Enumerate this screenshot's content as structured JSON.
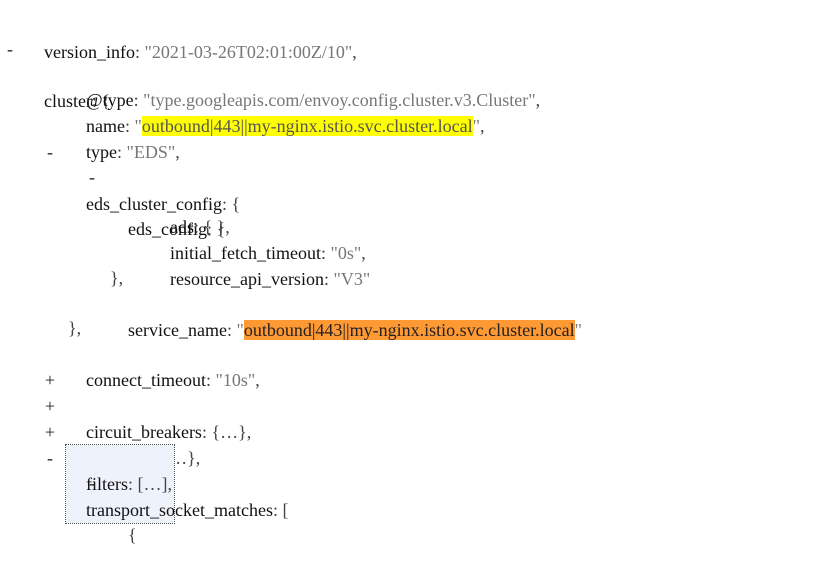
{
  "lines": {
    "version_info": {
      "key": "version_info",
      "value": "2021-03-26T02:01:00Z/10"
    },
    "cluster": {
      "toggle": "-",
      "key": "cluster",
      "open": "{"
    },
    "type_url": {
      "key": "@type",
      "value": "type.googleapis.com/envoy.config.cluster.v3.Cluster"
    },
    "name": {
      "key": "name",
      "value": "outbound|443||my-nginx.istio.svc.cluster.local"
    },
    "type": {
      "key": "type",
      "value": "EDS"
    },
    "eds_cluster_config": {
      "toggle": "-",
      "key": "eds_cluster_config",
      "open": "{"
    },
    "eds_config": {
      "toggle": "-",
      "key": "eds_config",
      "open": "{"
    },
    "ads": {
      "key": "ads",
      "value": "{ },"
    },
    "initial_fetch_timeout": {
      "key": "initial_fetch_timeout",
      "value": "0s"
    },
    "resource_api_version": {
      "key": "resource_api_version",
      "value": "V3"
    },
    "eds_config_close": {
      "text": "},"
    },
    "service_name": {
      "key": "service_name",
      "value": "outbound|443||my-nginx.istio.svc.cluster.local"
    },
    "eds_cluster_config_close": {
      "text": "},"
    },
    "connect_timeout": {
      "key": "connect_timeout",
      "value": "10s"
    },
    "circuit_breakers": {
      "toggle": "+",
      "key": "circuit_breakers",
      "value": "{…},"
    },
    "metadata": {
      "toggle": "+",
      "key": "metadata",
      "value": "{…},"
    },
    "filters": {
      "toggle": "+",
      "key": "filters",
      "value": "[…],"
    },
    "transport_socket_matches": {
      "toggle": "-",
      "key": "transport_socket_matches",
      "open": "["
    },
    "tsm_item": {
      "toggle": "-",
      "open": "{"
    }
  },
  "colors": {
    "highlight_name": "#ffff00",
    "highlight_service_name": "#ff9933"
  }
}
